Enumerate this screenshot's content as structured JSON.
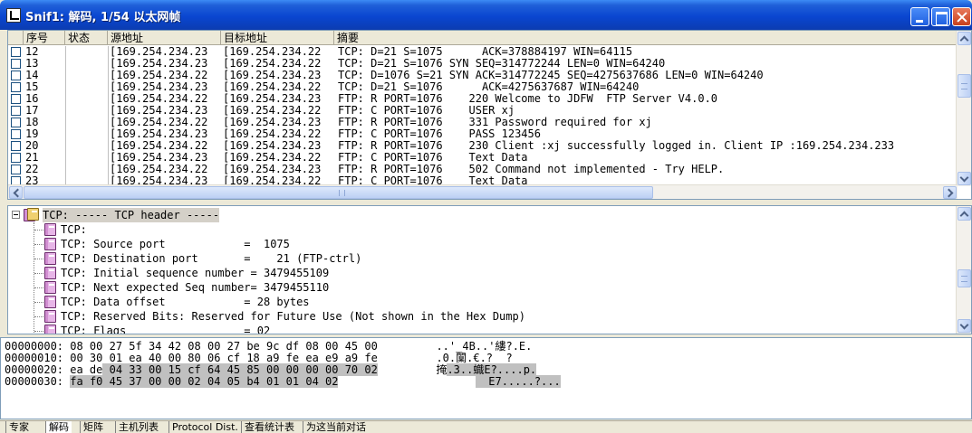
{
  "window": {
    "title": "Snif1: 解码, 1/54 以太网帧"
  },
  "packet_list": {
    "columns": [
      "序号",
      "状态",
      "源地址",
      "目标地址",
      "摘要"
    ],
    "rows": [
      {
        "no": "12",
        "src": "[169.254.234.23",
        "dst": "[169.254.234.22",
        "summary": "TCP: D=21 S=1075      ACK=378884197 WIN=64115"
      },
      {
        "no": "13",
        "src": "[169.254.234.23",
        "dst": "[169.254.234.22",
        "summary": "TCP: D=21 S=1076 SYN SEQ=314772244 LEN=0 WIN=64240"
      },
      {
        "no": "14",
        "src": "[169.254.234.22",
        "dst": "[169.254.234.23",
        "summary": "TCP: D=1076 S=21 SYN ACK=314772245 SEQ=4275637686 LEN=0 WIN=64240"
      },
      {
        "no": "15",
        "src": "[169.254.234.23",
        "dst": "[169.254.234.22",
        "summary": "TCP: D=21 S=1076      ACK=4275637687 WIN=64240"
      },
      {
        "no": "16",
        "src": "[169.254.234.22",
        "dst": "[169.254.234.23",
        "summary": "FTP: R PORT=1076    220 Welcome to JDFW  FTP Server V4.0.0"
      },
      {
        "no": "17",
        "src": "[169.254.234.23",
        "dst": "[169.254.234.22",
        "summary": "FTP: C PORT=1076    USER xj"
      },
      {
        "no": "18",
        "src": "[169.254.234.22",
        "dst": "[169.254.234.23",
        "summary": "FTP: R PORT=1076    331 Password required for xj"
      },
      {
        "no": "19",
        "src": "[169.254.234.23",
        "dst": "[169.254.234.22",
        "summary": "FTP: C PORT=1076    PASS 123456"
      },
      {
        "no": "20",
        "src": "[169.254.234.22",
        "dst": "[169.254.234.23",
        "summary": "FTP: R PORT=1076    230 Client :xj successfully logged in. Client IP :169.254.234.233"
      },
      {
        "no": "21",
        "src": "[169.254.234.23",
        "dst": "[169.254.234.22",
        "summary": "FTP: C PORT=1076    Text Data"
      },
      {
        "no": "22",
        "src": "[169.254.234.22",
        "dst": "[169.254.234.23",
        "summary": "FTP: R PORT=1076    502 Command not implemented - Try HELP."
      },
      {
        "no": "23",
        "src": "[169.254.234.23",
        "dst": "[169.254.234.22",
        "summary": "FTP: C PORT=1076    Text Data"
      }
    ]
  },
  "decode": {
    "root": "TCP: ----- TCP header -----",
    "items": [
      "TCP:",
      "TCP: Source port            =  1075",
      "TCP: Destination port       =    21 (FTP-ctrl)",
      "TCP: Initial sequence number = 3479455109",
      "TCP: Next expected Seq number= 3479455110",
      "TCP: Data offset            = 28 bytes",
      "TCP: Reserved Bits: Reserved for Future Use (Not shown in the Hex Dump)",
      "TCP: Flags                  = 02"
    ]
  },
  "hex": {
    "rows": [
      {
        "offset": "00000000:",
        "plain": " 08 00 27 5f 34 42 08 00 27 be 9c df 08 00 45 00",
        "hl": "",
        "ascii_plain": "  ..'_4B..'縷?.E.",
        "ascii_hl": ""
      },
      {
        "offset": "00000010:",
        "plain": " 00 30 01 ea 40 00 80 06 cf 18 a9 fe ea e9 a9 fe",
        "hl": "",
        "ascii_plain": "  .0.闑.€.?  ?",
        "ascii_hl": ""
      },
      {
        "offset": "00000020:",
        "plain": " ea de",
        "hl": " 04 33 00 15 cf 64 45 85 00 00 00 00 70 02",
        "ascii_plain": "  掩",
        "ascii_hl": ".3..蟙E?....p."
      },
      {
        "offset": "00000030:",
        "plain": " ",
        "hl": "fa f0 45 37 00 00 02 04 05 b4 01 01 04 02",
        "ascii_plain": "        ",
        "ascii_hl": "  E7.....?..."
      }
    ]
  },
  "tabs": [
    "专家",
    "解码",
    "矩阵",
    "主机列表",
    "Protocol Dist.",
    "查看统计表",
    "为这当前对话"
  ],
  "active_tab": 1
}
